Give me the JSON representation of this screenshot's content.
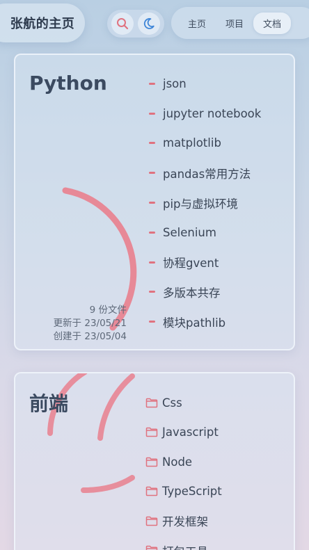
{
  "header": {
    "brand": "张航的主页",
    "icons": [
      "search-icon",
      "moon-icon"
    ],
    "nav": [
      {
        "label": "主页",
        "active": false
      },
      {
        "label": "项目",
        "active": false
      },
      {
        "label": "文档",
        "active": true
      }
    ]
  },
  "colors": {
    "accent": "#e0727f",
    "text": "#2f3d50"
  },
  "cards": [
    {
      "title": "Python",
      "items": [
        "json",
        "jupyter notebook",
        "matplotlib",
        "pandas常用方法",
        "pip与虚拟环境",
        "Selenium",
        "协程gvent",
        "多版本共存",
        "模块pathlib"
      ],
      "meta": {
        "count": "9 份文件",
        "updated": "更新于 23/05/21",
        "created": "创建于 23/05/04"
      }
    },
    {
      "title": "前端",
      "items": [
        "Css",
        "Javascript",
        "Node",
        "TypeScript",
        "开发框架",
        "打包工具"
      ]
    }
  ]
}
